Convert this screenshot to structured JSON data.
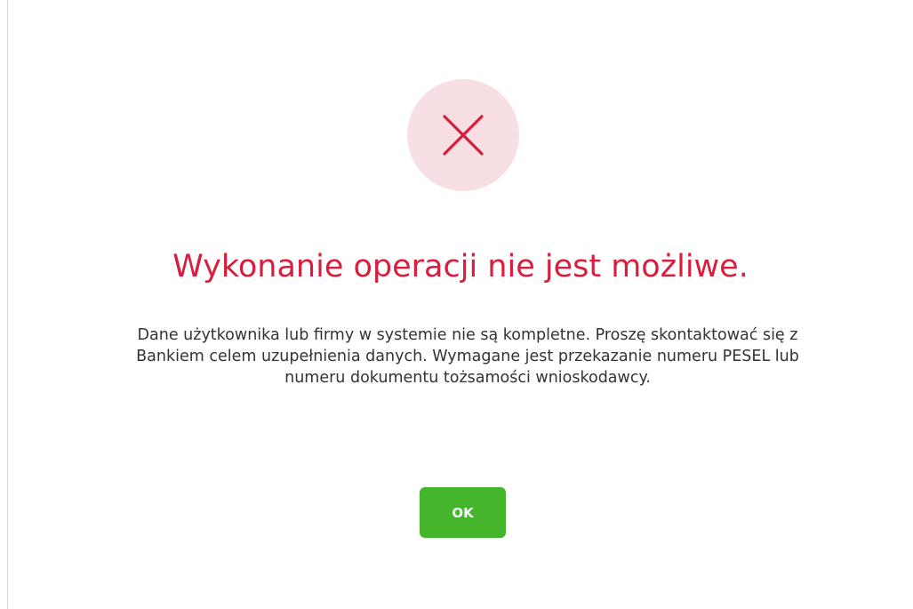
{
  "dialog": {
    "icon": "close-x-icon",
    "title": "Wykonanie operacji nie jest możliwe.",
    "message": "Dane użytkownika lub firmy w systemie nie są kompletne. Proszę skontaktować się z Bankiem celem uzupełnienia danych. Wymagane jest przekazanie numeru PESEL lub numeru dokumentu tożsamości wnioskodawcy.",
    "ok_label": "OK"
  },
  "colors": {
    "error_red": "#d81e3d",
    "error_circle_bg": "#f7dfe3",
    "ok_green": "#45b52c",
    "text": "#333333"
  }
}
